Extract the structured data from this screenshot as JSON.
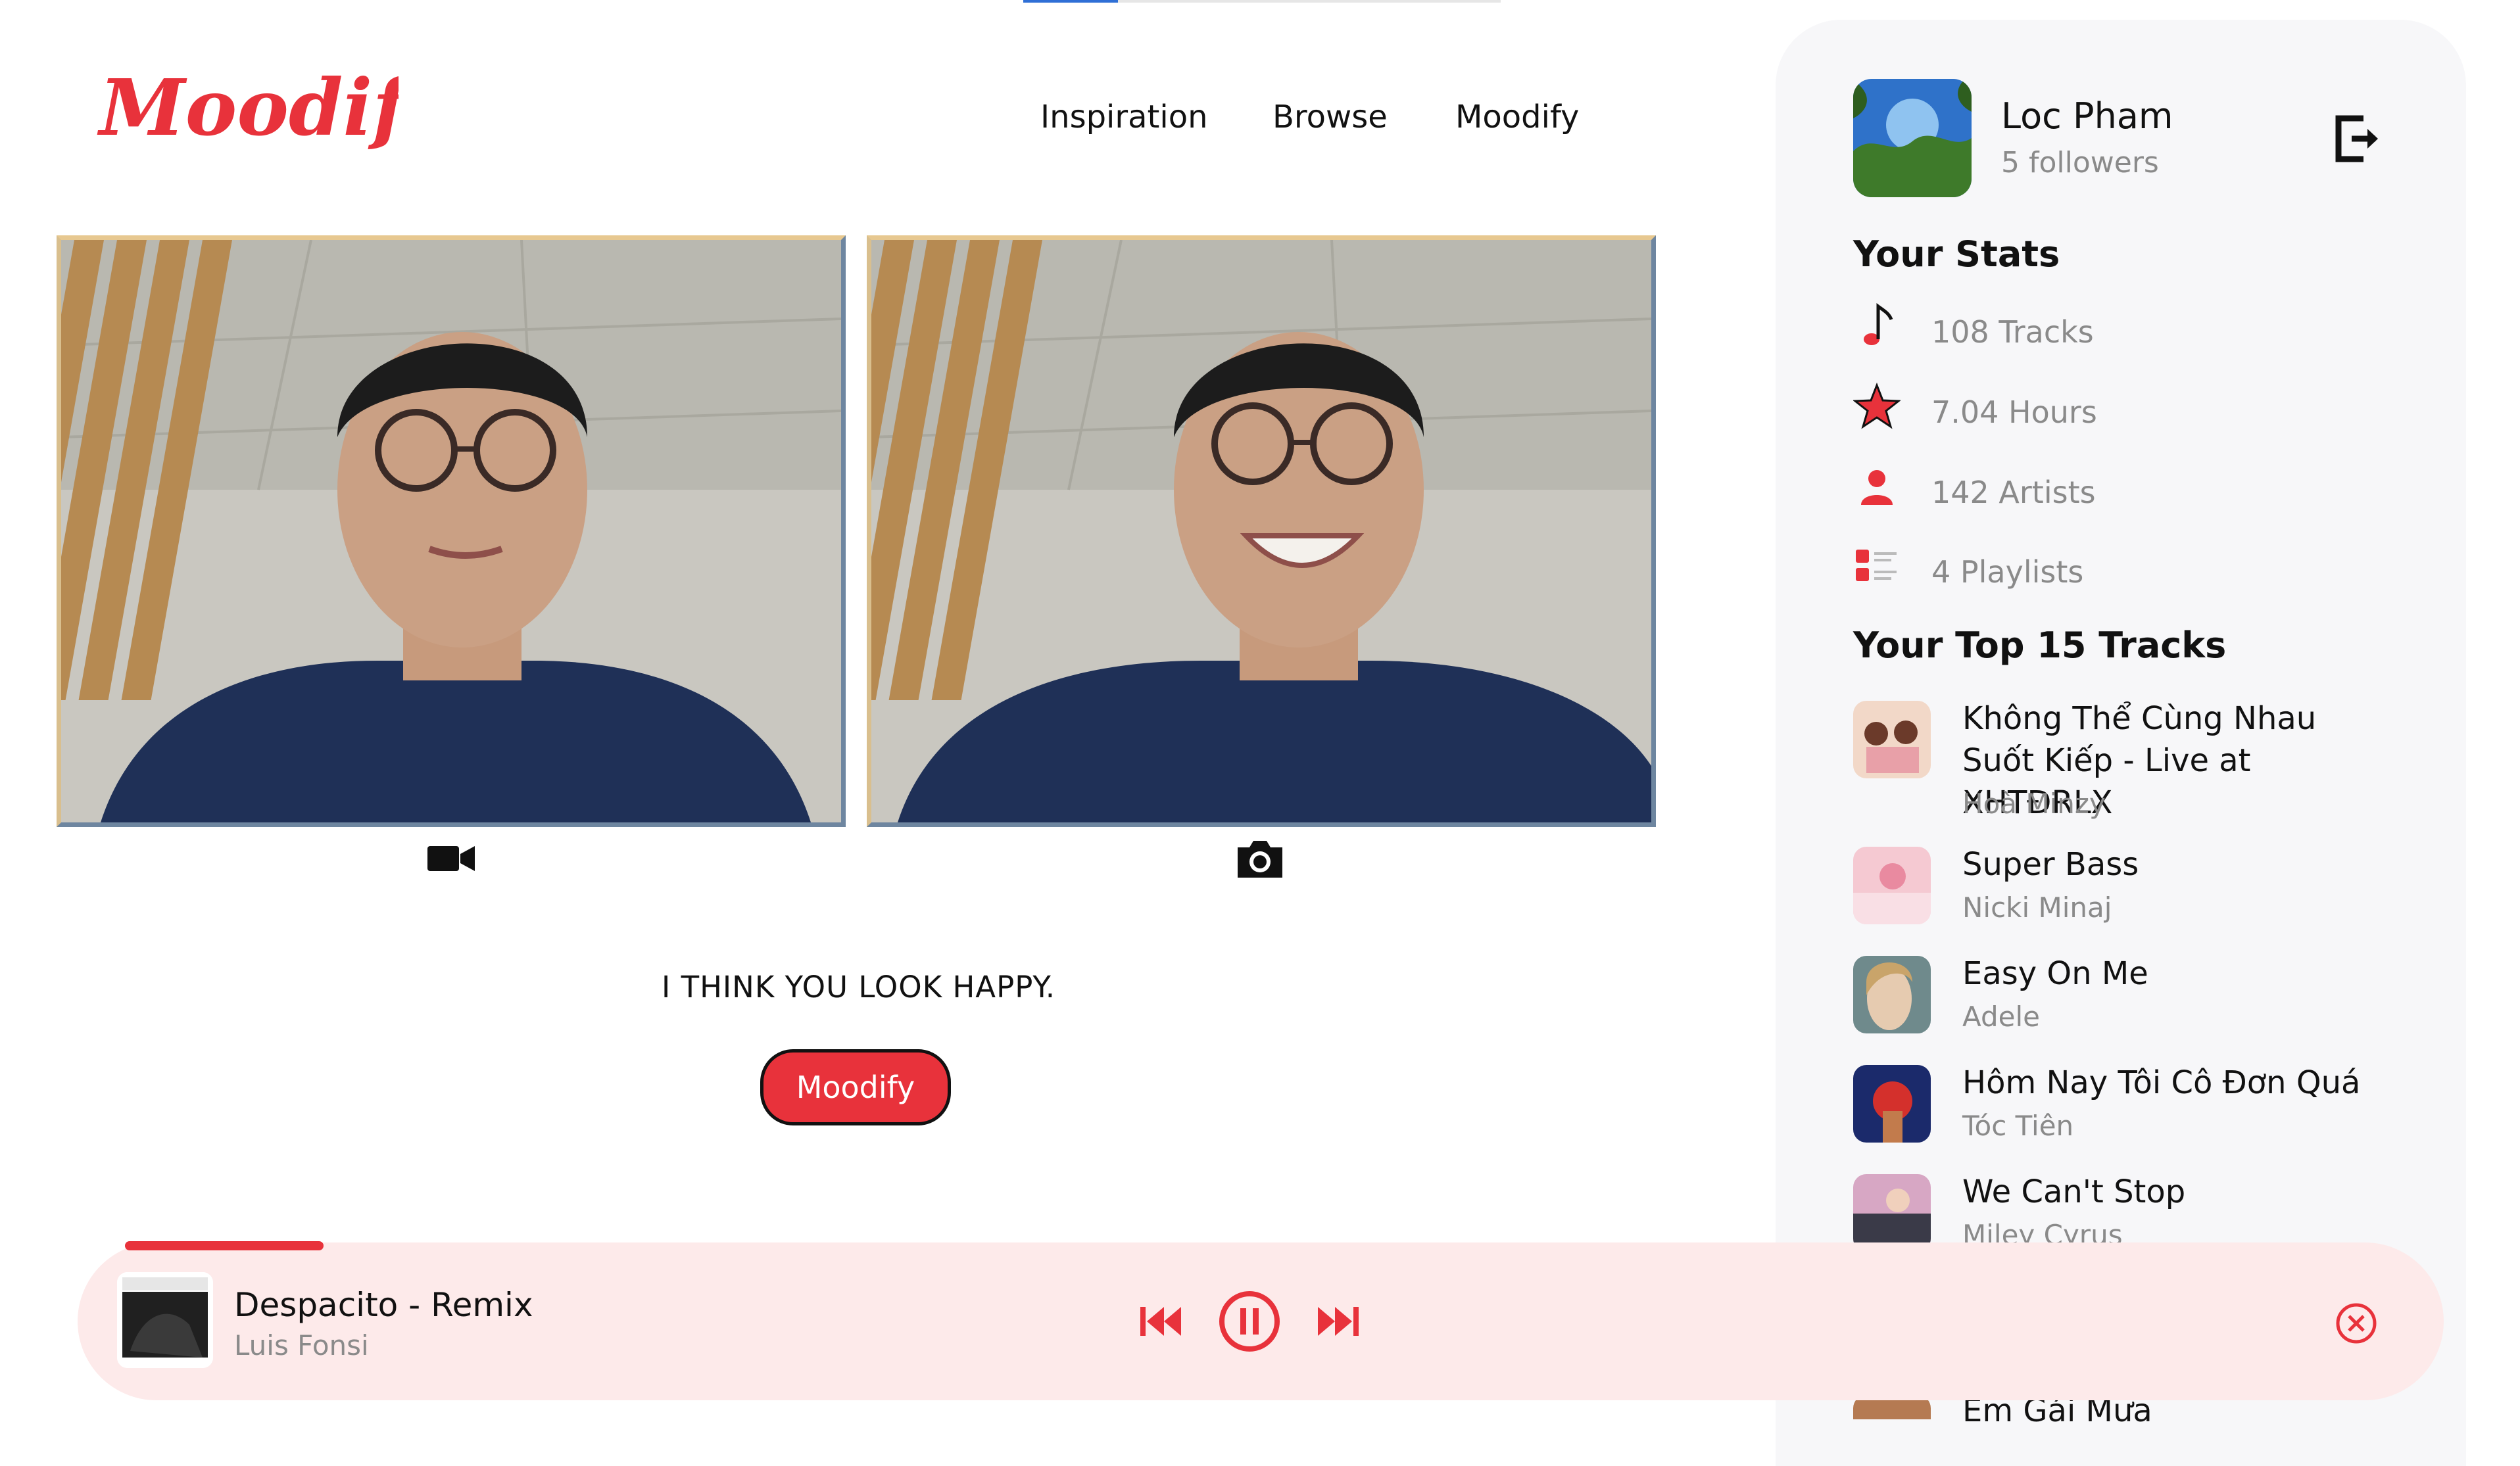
{
  "app": {
    "logo_text": "Moodify",
    "accent_color": "#e8323b"
  },
  "nav": {
    "items": [
      "Inspiration",
      "Browse",
      "Moodify"
    ]
  },
  "camera": {
    "left_icon": "video-camera-icon",
    "right_icon": "camera-icon",
    "mood_message": "I THINK YOU LOOK HAPPY.",
    "action_label": "Moodify"
  },
  "user": {
    "name": "Loc Pham",
    "followers": "5 followers"
  },
  "stats": {
    "title": "Your Stats",
    "items": [
      {
        "icon": "music-note-icon",
        "label": "108 Tracks"
      },
      {
        "icon": "star-icon",
        "label": "7.04 Hours"
      },
      {
        "icon": "person-icon",
        "label": "142 Artists"
      },
      {
        "icon": "playlist-icon",
        "label": "4 Playlists"
      }
    ]
  },
  "top_tracks": {
    "title": "Your Top 15 Tracks",
    "items": [
      {
        "title": "Không Thể Cùng Nhau Suốt Kiếp - Live at XHTĐRLX",
        "artist": "Hoà Minzy"
      },
      {
        "title": "Super Bass",
        "artist": "Nicki Minaj"
      },
      {
        "title": "Easy On Me",
        "artist": "Adele"
      },
      {
        "title": "Hôm Nay Tôi Cô Đơn Quá",
        "artist": "Tóc Tiên"
      },
      {
        "title": "We Can't Stop",
        "artist": "Miley Cyrus"
      },
      {
        "title": "Em Gái Mưa",
        "artist": ""
      }
    ]
  },
  "player": {
    "title": "Despacito - Remix",
    "artist": "Luis Fonsi",
    "progress": 0.09
  }
}
